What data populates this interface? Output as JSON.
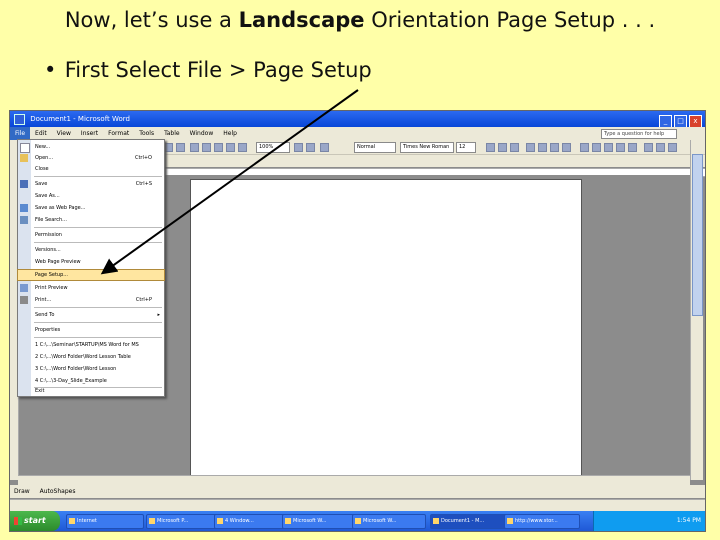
{
  "slide": {
    "title_pre": "Now, let’s use a ",
    "title_bold": "Landscape",
    "title_post": " Orientation Page Setup . . .",
    "bullet": "First Select File > Page Setup",
    "bullet_marker": "•"
  },
  "window": {
    "title": "Document1 - Microsoft Word",
    "help_placeholder": "Type a question for help",
    "buttons": [
      "_",
      "□",
      "x"
    ]
  },
  "menubar": {
    "items": [
      "File",
      "Edit",
      "View",
      "Insert",
      "Format",
      "Tools",
      "Table",
      "Window",
      "Help"
    ]
  },
  "toolbar": {
    "zoom": "100%",
    "style": "Normal",
    "font": "Times New Roman",
    "size": "12"
  },
  "file_menu": {
    "items": [
      {
        "label": "New...",
        "shortcut": "",
        "icon": "new-document-icon"
      },
      {
        "label": "Open...",
        "shortcut": "Ctrl+O",
        "icon": "open-folder-icon"
      },
      {
        "label": "Close",
        "shortcut": "",
        "icon": ""
      },
      {
        "label": "Save",
        "shortcut": "Ctrl+S",
        "icon": "save-icon"
      },
      {
        "label": "Save As...",
        "shortcut": "",
        "icon": ""
      },
      {
        "label": "Save as Web Page...",
        "shortcut": "",
        "icon": "web-page-icon"
      },
      {
        "label": "File Search...",
        "shortcut": "",
        "icon": "search-icon"
      },
      {
        "label": "Permission",
        "shortcut": "",
        "icon": ""
      },
      {
        "label": "Versions...",
        "shortcut": "",
        "icon": ""
      },
      {
        "label": "Web Page Preview",
        "shortcut": "",
        "icon": ""
      },
      {
        "label": "Page Setup...",
        "shortcut": "",
        "icon": ""
      },
      {
        "label": "Print Preview",
        "shortcut": "",
        "icon": "print-preview-icon"
      },
      {
        "label": "Print...",
        "shortcut": "Ctrl+P",
        "icon": "printer-icon"
      },
      {
        "label": "Send To",
        "shortcut": "",
        "icon": ""
      },
      {
        "label": "Properties",
        "shortcut": "",
        "icon": ""
      },
      {
        "label": "1 C:\\...\\Seminar\\STARTUP\\MS Word for MS",
        "shortcut": "",
        "icon": ""
      },
      {
        "label": "2 C:\\...\\Word Folder\\Word Lesson Table",
        "shortcut": "",
        "icon": ""
      },
      {
        "label": "3 C:\\...\\Word Folder\\Word Lesson",
        "shortcut": "",
        "icon": ""
      },
      {
        "label": "4 C:\\...\\3-Day_Slide_Example",
        "shortcut": "",
        "icon": ""
      },
      {
        "label": "Exit",
        "shortcut": "",
        "icon": ""
      }
    ]
  },
  "drawing_toolbar": {
    "draw": "Draw",
    "autoshapes": "AutoShapes"
  },
  "taskbar": {
    "start": "start",
    "tasks": [
      {
        "label": "Internet"
      },
      {
        "label": "Microsoft P..."
      },
      {
        "label": "4 Window..."
      },
      {
        "label": "Microsoft W..."
      },
      {
        "label": "Microsoft W..."
      },
      {
        "label": "Document1 - M..."
      },
      {
        "label": "http://www.stor..."
      }
    ],
    "clock": "1:54 PM"
  },
  "colors": {
    "slide_bg": "#ffffa8",
    "highlight": "#ffe6a0",
    "titlebar": "#0846d8"
  }
}
